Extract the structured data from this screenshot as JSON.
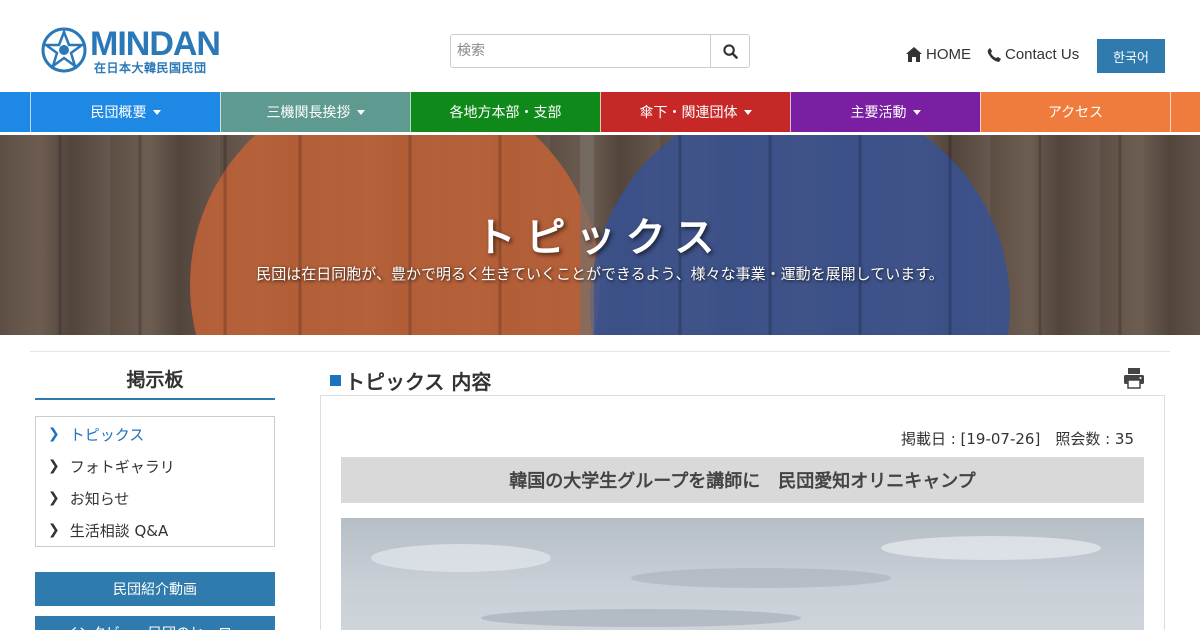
{
  "header": {
    "logo_text": "MINDAN",
    "logo_sub": "在日本大韓民国民団",
    "search_placeholder": "検索",
    "home_label": "HOME",
    "contact_label": "Contact Us",
    "lang_label": "한국어"
  },
  "nav": {
    "items": [
      {
        "label": "民団概要",
        "color": "#1e88e5"
      },
      {
        "label": "三機関長挨拶",
        "color": "#5f9a90"
      },
      {
        "label": "各地方本部・支部",
        "color": "#0f8a1a"
      },
      {
        "label": "傘下・関連団体",
        "color": "#c62828"
      },
      {
        "label": "主要活動",
        "color": "#7b1fa2"
      },
      {
        "label": "アクセス",
        "color": "#ef7b3c"
      }
    ]
  },
  "hero": {
    "title": "トピックス",
    "subtitle": "民団は在日同胞が、豊かで明るく生きていくことができるよう、様々な事業・運動を展開しています。"
  },
  "sidebar": {
    "title": "掲示板",
    "items": [
      {
        "label": "トピックス"
      },
      {
        "label": "フォトギャラリ"
      },
      {
        "label": "お知らせ"
      },
      {
        "label": "生活相談 Q&A"
      }
    ],
    "buttons": [
      {
        "label": "民団紹介動画"
      },
      {
        "label": "インタビュー民団のヒーロー"
      }
    ]
  },
  "main": {
    "title": "トピックス 内容",
    "meta": "掲載日 : [19-07-26]　照会数 : 35",
    "article_title": "韓国の大学生グループを講師に　民団愛知オリニキャンプ"
  },
  "colors": {
    "accent": "#2f7bad",
    "link": "#1e73be"
  }
}
